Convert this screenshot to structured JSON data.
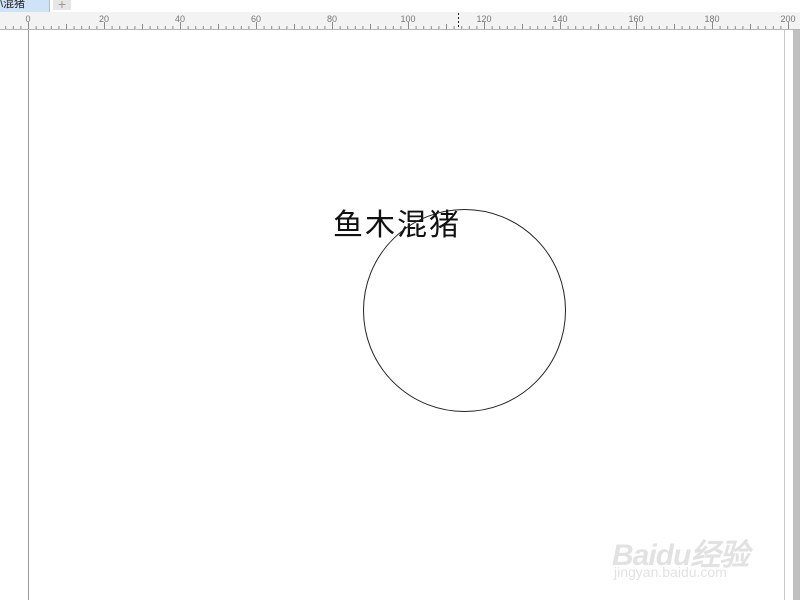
{
  "document_tab": {
    "label": "\\混猪"
  },
  "new_tab": {
    "label": "+"
  },
  "ruler": {
    "labels": [
      "0",
      "20",
      "40",
      "60",
      "80",
      "100",
      "120",
      "140",
      "160",
      "180",
      "200"
    ]
  },
  "canvas": {
    "text": "鱼木混猪"
  },
  "watermark": {
    "logo": "Baidu经验",
    "url": "jingyan.baidu.com"
  }
}
